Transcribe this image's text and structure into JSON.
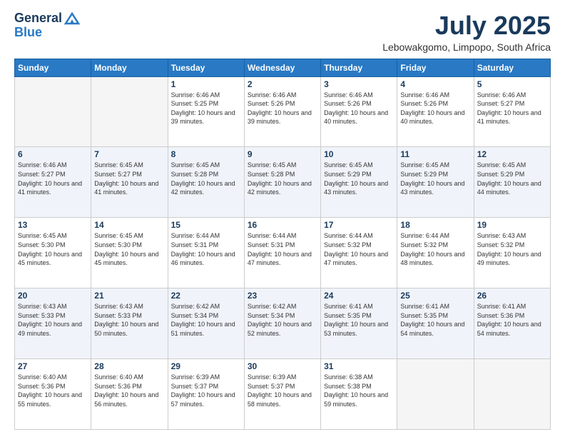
{
  "header": {
    "logo_line1": "General",
    "logo_line2": "Blue",
    "month": "July 2025",
    "location": "Lebowakgomo, Limpopo, South Africa"
  },
  "weekdays": [
    "Sunday",
    "Monday",
    "Tuesday",
    "Wednesday",
    "Thursday",
    "Friday",
    "Saturday"
  ],
  "weeks": [
    [
      {
        "day": "",
        "sunrise": "",
        "sunset": "",
        "daylight": ""
      },
      {
        "day": "",
        "sunrise": "",
        "sunset": "",
        "daylight": ""
      },
      {
        "day": "1",
        "sunrise": "Sunrise: 6:46 AM",
        "sunset": "Sunset: 5:25 PM",
        "daylight": "Daylight: 10 hours and 39 minutes."
      },
      {
        "day": "2",
        "sunrise": "Sunrise: 6:46 AM",
        "sunset": "Sunset: 5:26 PM",
        "daylight": "Daylight: 10 hours and 39 minutes."
      },
      {
        "day": "3",
        "sunrise": "Sunrise: 6:46 AM",
        "sunset": "Sunset: 5:26 PM",
        "daylight": "Daylight: 10 hours and 40 minutes."
      },
      {
        "day": "4",
        "sunrise": "Sunrise: 6:46 AM",
        "sunset": "Sunset: 5:26 PM",
        "daylight": "Daylight: 10 hours and 40 minutes."
      },
      {
        "day": "5",
        "sunrise": "Sunrise: 6:46 AM",
        "sunset": "Sunset: 5:27 PM",
        "daylight": "Daylight: 10 hours and 41 minutes."
      }
    ],
    [
      {
        "day": "6",
        "sunrise": "Sunrise: 6:46 AM",
        "sunset": "Sunset: 5:27 PM",
        "daylight": "Daylight: 10 hours and 41 minutes."
      },
      {
        "day": "7",
        "sunrise": "Sunrise: 6:45 AM",
        "sunset": "Sunset: 5:27 PM",
        "daylight": "Daylight: 10 hours and 41 minutes."
      },
      {
        "day": "8",
        "sunrise": "Sunrise: 6:45 AM",
        "sunset": "Sunset: 5:28 PM",
        "daylight": "Daylight: 10 hours and 42 minutes."
      },
      {
        "day": "9",
        "sunrise": "Sunrise: 6:45 AM",
        "sunset": "Sunset: 5:28 PM",
        "daylight": "Daylight: 10 hours and 42 minutes."
      },
      {
        "day": "10",
        "sunrise": "Sunrise: 6:45 AM",
        "sunset": "Sunset: 5:29 PM",
        "daylight": "Daylight: 10 hours and 43 minutes."
      },
      {
        "day": "11",
        "sunrise": "Sunrise: 6:45 AM",
        "sunset": "Sunset: 5:29 PM",
        "daylight": "Daylight: 10 hours and 43 minutes."
      },
      {
        "day": "12",
        "sunrise": "Sunrise: 6:45 AM",
        "sunset": "Sunset: 5:29 PM",
        "daylight": "Daylight: 10 hours and 44 minutes."
      }
    ],
    [
      {
        "day": "13",
        "sunrise": "Sunrise: 6:45 AM",
        "sunset": "Sunset: 5:30 PM",
        "daylight": "Daylight: 10 hours and 45 minutes."
      },
      {
        "day": "14",
        "sunrise": "Sunrise: 6:45 AM",
        "sunset": "Sunset: 5:30 PM",
        "daylight": "Daylight: 10 hours and 45 minutes."
      },
      {
        "day": "15",
        "sunrise": "Sunrise: 6:44 AM",
        "sunset": "Sunset: 5:31 PM",
        "daylight": "Daylight: 10 hours and 46 minutes."
      },
      {
        "day": "16",
        "sunrise": "Sunrise: 6:44 AM",
        "sunset": "Sunset: 5:31 PM",
        "daylight": "Daylight: 10 hours and 47 minutes."
      },
      {
        "day": "17",
        "sunrise": "Sunrise: 6:44 AM",
        "sunset": "Sunset: 5:32 PM",
        "daylight": "Daylight: 10 hours and 47 minutes."
      },
      {
        "day": "18",
        "sunrise": "Sunrise: 6:44 AM",
        "sunset": "Sunset: 5:32 PM",
        "daylight": "Daylight: 10 hours and 48 minutes."
      },
      {
        "day": "19",
        "sunrise": "Sunrise: 6:43 AM",
        "sunset": "Sunset: 5:32 PM",
        "daylight": "Daylight: 10 hours and 49 minutes."
      }
    ],
    [
      {
        "day": "20",
        "sunrise": "Sunrise: 6:43 AM",
        "sunset": "Sunset: 5:33 PM",
        "daylight": "Daylight: 10 hours and 49 minutes."
      },
      {
        "day": "21",
        "sunrise": "Sunrise: 6:43 AM",
        "sunset": "Sunset: 5:33 PM",
        "daylight": "Daylight: 10 hours and 50 minutes."
      },
      {
        "day": "22",
        "sunrise": "Sunrise: 6:42 AM",
        "sunset": "Sunset: 5:34 PM",
        "daylight": "Daylight: 10 hours and 51 minutes."
      },
      {
        "day": "23",
        "sunrise": "Sunrise: 6:42 AM",
        "sunset": "Sunset: 5:34 PM",
        "daylight": "Daylight: 10 hours and 52 minutes."
      },
      {
        "day": "24",
        "sunrise": "Sunrise: 6:41 AM",
        "sunset": "Sunset: 5:35 PM",
        "daylight": "Daylight: 10 hours and 53 minutes."
      },
      {
        "day": "25",
        "sunrise": "Sunrise: 6:41 AM",
        "sunset": "Sunset: 5:35 PM",
        "daylight": "Daylight: 10 hours and 54 minutes."
      },
      {
        "day": "26",
        "sunrise": "Sunrise: 6:41 AM",
        "sunset": "Sunset: 5:36 PM",
        "daylight": "Daylight: 10 hours and 54 minutes."
      }
    ],
    [
      {
        "day": "27",
        "sunrise": "Sunrise: 6:40 AM",
        "sunset": "Sunset: 5:36 PM",
        "daylight": "Daylight: 10 hours and 55 minutes."
      },
      {
        "day": "28",
        "sunrise": "Sunrise: 6:40 AM",
        "sunset": "Sunset: 5:36 PM",
        "daylight": "Daylight: 10 hours and 56 minutes."
      },
      {
        "day": "29",
        "sunrise": "Sunrise: 6:39 AM",
        "sunset": "Sunset: 5:37 PM",
        "daylight": "Daylight: 10 hours and 57 minutes."
      },
      {
        "day": "30",
        "sunrise": "Sunrise: 6:39 AM",
        "sunset": "Sunset: 5:37 PM",
        "daylight": "Daylight: 10 hours and 58 minutes."
      },
      {
        "day": "31",
        "sunrise": "Sunrise: 6:38 AM",
        "sunset": "Sunset: 5:38 PM",
        "daylight": "Daylight: 10 hours and 59 minutes."
      },
      {
        "day": "",
        "sunrise": "",
        "sunset": "",
        "daylight": ""
      },
      {
        "day": "",
        "sunrise": "",
        "sunset": "",
        "daylight": ""
      }
    ]
  ]
}
